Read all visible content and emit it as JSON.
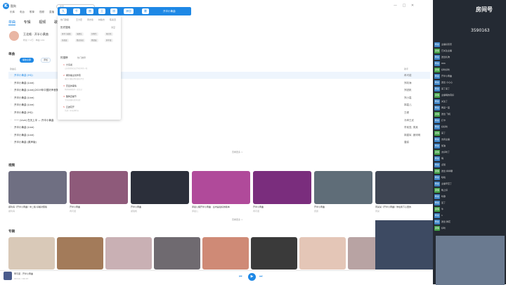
{
  "app": {
    "name": "酷狗",
    "logo": "K"
  },
  "top_nav": [
    "乐库",
    "电台",
    "歌单",
    "视频",
    "直播"
  ],
  "search": {
    "placeholder": "搜索"
  },
  "tab_chips": [
    "九",
    "千",
    "曲",
    "王",
    "凉",
    "洲谷",
    "匯"
  ],
  "now_tab": "开半小黄曲",
  "window_controls": "— □ ✕",
  "sidebar_tabs": [
    "单曲",
    "专辑",
    "视频",
    "歌单",
    "MV"
  ],
  "artist": {
    "name": "王北格 · 开半小黄曲",
    "sub": "粉丝 7.2万 · 单曲 149"
  },
  "songs": {
    "heading": "单曲",
    "play_all": "播放全部",
    "add": "添加",
    "col_song": "歌曲名",
    "col_artist": "歌手",
    "rows": [
      {
        "title": "开半小黄曲 (HQ)",
        "album": "",
        "artist": "冉可诺",
        "highlight": true
      },
      {
        "title": "开半小黄曲 (Live)",
        "album": "",
        "artist": "郑钧海"
      },
      {
        "title": "开半小黄曲 (Live)(2019年中国好声音第三季)",
        "album": "",
        "artist": "郑锐帆"
      },
      {
        "title": "开半小黄曲 (Live)",
        "album": "",
        "artist": "郑小嘉"
      },
      {
        "title": "开半小黄曲 (Live)",
        "album": "",
        "artist": "郭嘉儿"
      },
      {
        "title": "开半小黄曲 (HQ)",
        "album": "",
        "artist": "王峰"
      },
      {
        "title": "一一 (Live) 在天上半 — 开半小黄曲",
        "album": "",
        "artist": "冯坤王武"
      },
      {
        "title": "开半小黄曲 (Live)",
        "album": "",
        "artist": "李某鸾, 周某"
      },
      {
        "title": "开半小黄曲 (Live)",
        "album": "",
        "artist": "郭建军, 窦明明"
      },
      {
        "title": "开半小黄曲 (原声版)",
        "album": "",
        "artist": "唐爵"
      }
    ],
    "more": "查看更多 >"
  },
  "videos": {
    "heading": "视频",
    "more": "查看更多 >",
    "items": [
      {
        "cap": "郑钧海《开半小黄曲》中二版 好嗓对照版",
        "sub": "郑钧海",
        "color": "#6f6f82"
      },
      {
        "cap": "开半小黄曲",
        "sub": "冉可诺",
        "color": "#8e5a7a"
      },
      {
        "cap": "开半小黄曲",
        "sub": "郑锐帆",
        "color": "#2b2f3a"
      },
      {
        "cap": "郭嘉儿唱开半小黄曲 · 业内是最好的版本",
        "sub": "郭嘉儿",
        "color": "#b04a9a"
      },
      {
        "cap": "开半小黄曲",
        "sub": "冉可诺",
        "color": "#7a2d7d"
      },
      {
        "cap": "开半小黄曲",
        "sub": "唐爵",
        "color": "#5f6d78"
      },
      {
        "cap": "周某某《开半小黄曲》你在我下心里的",
        "sub": "周某",
        "color": "#3f4654"
      }
    ]
  },
  "albums": {
    "heading": "专辑",
    "colors": [
      "#d9c9b8",
      "#a37b5a",
      "#c9b0b4",
      "#6f6a70",
      "#cf8a76",
      "#3a3a3a",
      "#e4c6b7",
      "#b8a3a3"
    ]
  },
  "player": {
    "title": "李可诺 - 开半小黄曲",
    "time": "00:12 / 04:23",
    "play": "▶",
    "prev": "⏮",
    "next": "⏭"
  },
  "dropdown": {
    "recent_label": "热门歌星",
    "recent_links": [
      "王力宏",
      "周杰伦",
      "林俊杰",
      "陈奕迅"
    ],
    "history_label": "历史搜索",
    "clear": "清空",
    "history_tags": [
      "开半小黄曲",
      "张震岳",
      "万物生",
      "杨宗纬",
      "孙燕姿",
      "精灵乐队",
      "窦靖童",
      "开半谁"
    ],
    "hot_label": "热搜榜",
    "hot_alt": "热门推荐",
    "hot_items": [
      {
        "n": "1",
        "t": "大鸟说",
        "s": "山东新型农业合作社中的一粒"
      },
      {
        "n": "2",
        "t": "爆款播主创作营",
        "s": "播主们都在用的发布平台"
      },
      {
        "n": "3",
        "t": "恋爱的事情",
        "s": "风风雨雨陪你一起走过"
      },
      {
        "n": "4",
        "t": "酷狗直播节",
        "s": "今天直播有超多惊喜"
      },
      {
        "n": "5",
        "t": "云迹花开",
        "s": "又是一年花开时节"
      }
    ]
  },
  "stream": {
    "room": "房间号",
    "number": "3590163",
    "chat": [
      {
        "b": "粉丝",
        "t": "主播好厉害"
      },
      {
        "b": "贵族",
        "t": "已关注主播"
      },
      {
        "b": "粉丝",
        "t": "送出礼物"
      },
      {
        "b": "粉丝",
        "t": "666"
      },
      {
        "b": "贵族",
        "t": "好听好听"
      },
      {
        "b": "粉丝",
        "t": "开半小黄曲"
      },
      {
        "b": "粉丝",
        "t": "送出 小心心"
      },
      {
        "b": "粉丝",
        "t": "来了来了"
      },
      {
        "b": "贵族",
        "t": "主播唱的真好"
      },
      {
        "b": "粉丝",
        "t": "关注了"
      },
      {
        "b": "粉丝",
        "t": "再来一首"
      },
      {
        "b": "贵族",
        "t": "送出 飞机"
      },
      {
        "b": "粉丝",
        "t": "打卡"
      },
      {
        "b": "粉丝",
        "t": "好好听"
      },
      {
        "b": "贵族",
        "t": "来了"
      },
      {
        "b": "粉丝",
        "t": "支持主播"
      },
      {
        "b": "粉丝",
        "t": "加油"
      },
      {
        "b": "贵族",
        "t": "太好听了"
      },
      {
        "b": "粉丝",
        "t": "嗨"
      },
      {
        "b": "粉丝",
        "t": "点赞"
      },
      {
        "b": "贵族",
        "t": "送出 棒棒糖"
      },
      {
        "b": "粉丝",
        "t": "哈哈"
      },
      {
        "b": "粉丝",
        "t": "主播辛苦了"
      },
      {
        "b": "贵族",
        "t": "晚上好"
      },
      {
        "b": "粉丝",
        "t": "听歌"
      },
      {
        "b": "粉丝",
        "t": "爱了"
      },
      {
        "b": "贵族",
        "t": "牛"
      },
      {
        "b": "粉丝",
        "t": "1"
      },
      {
        "b": "粉丝",
        "t": "送出 鲜花"
      },
      {
        "b": "贵族",
        "t": "好听"
      }
    ]
  }
}
